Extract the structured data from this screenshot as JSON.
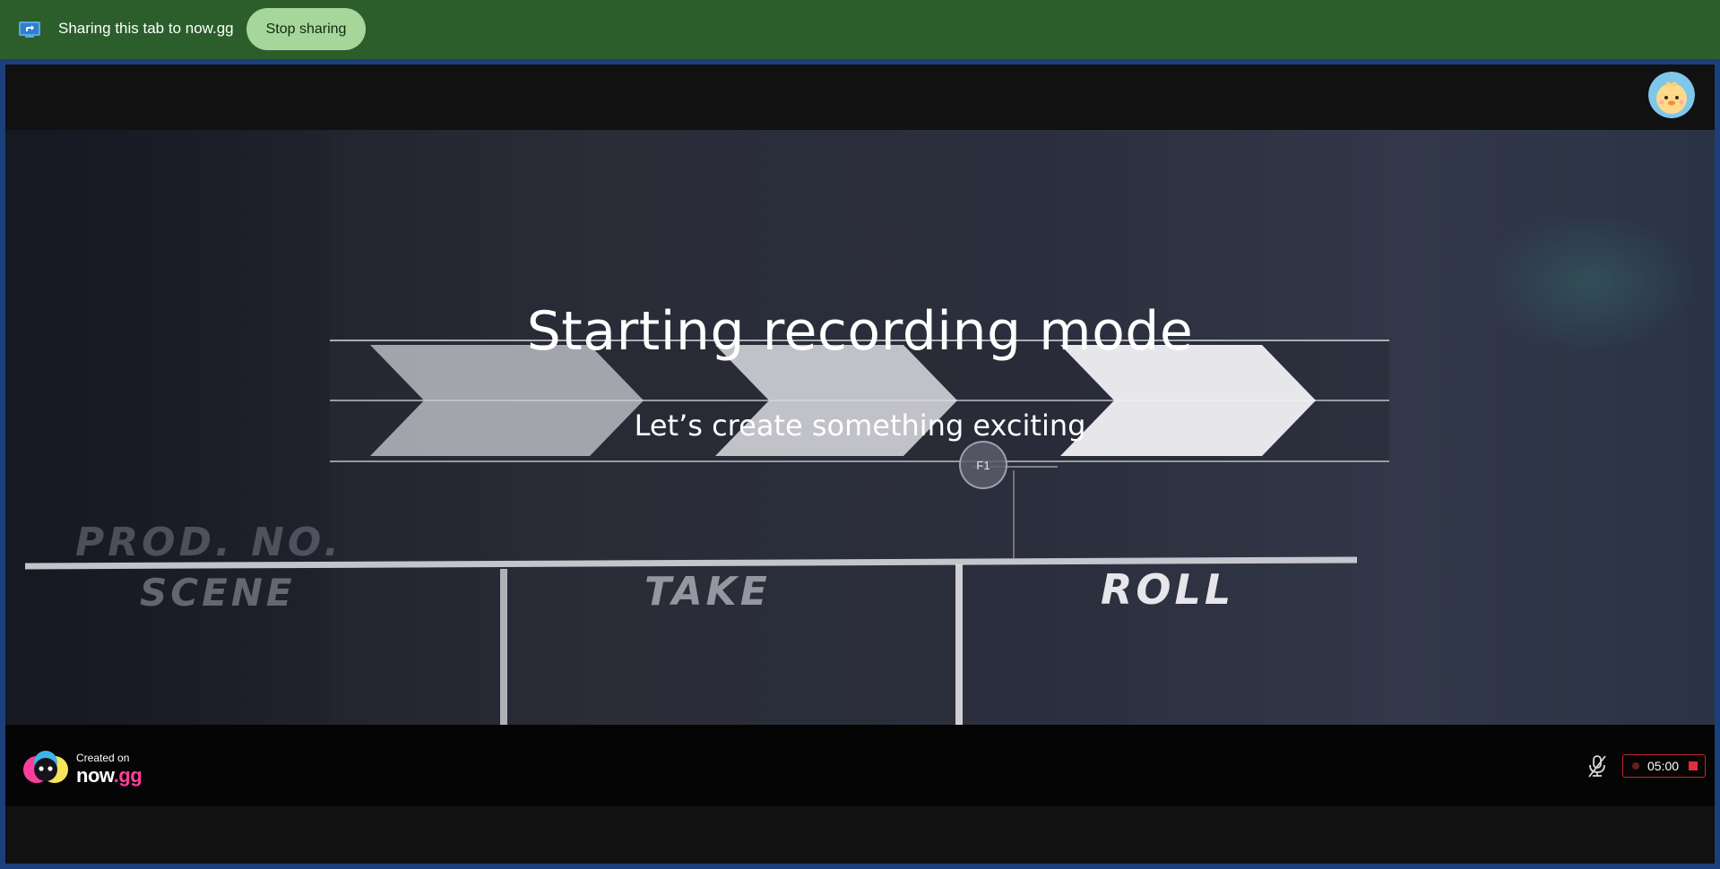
{
  "share_bar": {
    "message": "Sharing this tab to now.gg",
    "stop_label": "Stop sharing",
    "icon": "screen-share-icon",
    "background": "#2b5e2b",
    "button_color": "#a7d69a"
  },
  "header": {
    "avatar_icon": "chick-avatar-icon"
  },
  "overlay": {
    "title": "Starting recording mode",
    "subtitle": "Let’s create something exciting",
    "marker_label": "F1"
  },
  "slate": {
    "prod_no": "PROD. NO.",
    "scene": "SCENE",
    "take": "TAKE",
    "roll": "ROLL"
  },
  "footer": {
    "created_on": "Created on",
    "brand_now": "now",
    "brand_gg": ".gg",
    "mic_icon": "mic-muted-icon",
    "timer": "05:00",
    "record_color": "#e0303a"
  }
}
